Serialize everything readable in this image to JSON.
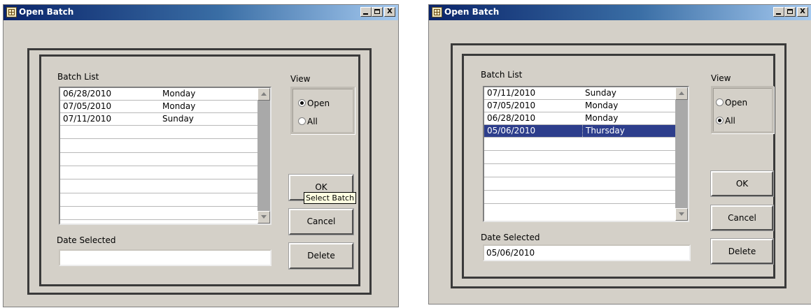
{
  "windows": [
    {
      "title": "Open Batch",
      "batch_list_label": "Batch List",
      "view_label": "View",
      "rows": [
        {
          "date": "06/28/2010",
          "day": "Monday",
          "selected": false
        },
        {
          "date": "07/05/2010",
          "day": "Monday",
          "selected": false
        },
        {
          "date": "07/11/2010",
          "day": "Sunday",
          "selected": false
        }
      ],
      "view_options": [
        {
          "label": "Open",
          "checked": true
        },
        {
          "label": "All",
          "checked": false
        }
      ],
      "buttons": {
        "ok": "OK",
        "cancel": "Cancel",
        "delete": "Delete"
      },
      "tooltip": "Select Batch",
      "date_selected_label": "Date Selected",
      "date_selected_value": ""
    },
    {
      "title": "Open Batch",
      "batch_list_label": "Batch List",
      "view_label": "View",
      "rows": [
        {
          "date": "07/11/2010",
          "day": "Sunday",
          "selected": false
        },
        {
          "date": "07/05/2010",
          "day": "Monday",
          "selected": false
        },
        {
          "date": "06/28/2010",
          "day": "Monday",
          "selected": false
        },
        {
          "date": "05/06/2010",
          "day": "Thursday",
          "selected": true
        }
      ],
      "view_options": [
        {
          "label": "Open",
          "checked": false
        },
        {
          "label": "All",
          "checked": true
        }
      ],
      "buttons": {
        "ok": "OK",
        "cancel": "Cancel",
        "delete": "Delete"
      },
      "date_selected_label": "Date Selected",
      "date_selected_value": "05/06/2010"
    }
  ],
  "titlebar_buttons": {
    "minimize": "_",
    "maximize": "□",
    "close": "X"
  },
  "colors": {
    "titlebar_start": "#0a246a",
    "titlebar_end": "#a6caf0",
    "dialog_bg": "#d4d0c8",
    "selection": "#2d3e8c"
  }
}
